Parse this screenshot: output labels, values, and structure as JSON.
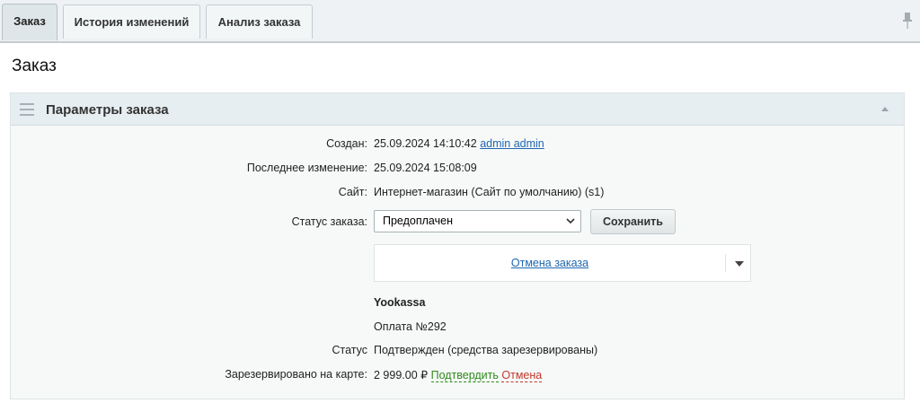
{
  "tabs": [
    {
      "label": "Заказ",
      "active": true
    },
    {
      "label": "История изменений",
      "active": false
    },
    {
      "label": "Анализ заказа",
      "active": false
    }
  ],
  "page_title": "Заказ",
  "panel": {
    "title": "Параметры заказа",
    "created_label": "Создан:",
    "created_value": "25.09.2024 14:10:42",
    "created_by": "admin admin",
    "modified_label": "Последнее изменение:",
    "modified_value": "25.09.2024 15:08:09",
    "site_label": "Сайт:",
    "site_value": "Интернет-магазин (Сайт по умолчанию) (s1)",
    "status_label": "Статус заказа:",
    "status_selected": "Предоплачен",
    "save_label": "Сохранить",
    "cancel_order_label": "Отмена заказа",
    "payment_system": "Yookassa",
    "payment_number": "Оплата №292",
    "payment_status_label": "Статус",
    "payment_status_value": "Подтвержден (средства зарезервированы)",
    "reserved_label": "Зарезервировано на карте:",
    "reserved_amount": "2 999.00 ₽",
    "confirm_label": "Подтвердить",
    "cancel_label": "Отмена"
  },
  "icons": {
    "pin": "pin-icon",
    "drag": "drag-handle-icon",
    "collapse": "collapse-arrow-icon",
    "select": "chevron-down-icon",
    "menu": "dropdown-arrow-icon"
  },
  "colors": {
    "link": "#2067b0",
    "confirm": "#2f8a1c",
    "cancel": "#c0392b",
    "header_bg": "#e6eef1"
  }
}
